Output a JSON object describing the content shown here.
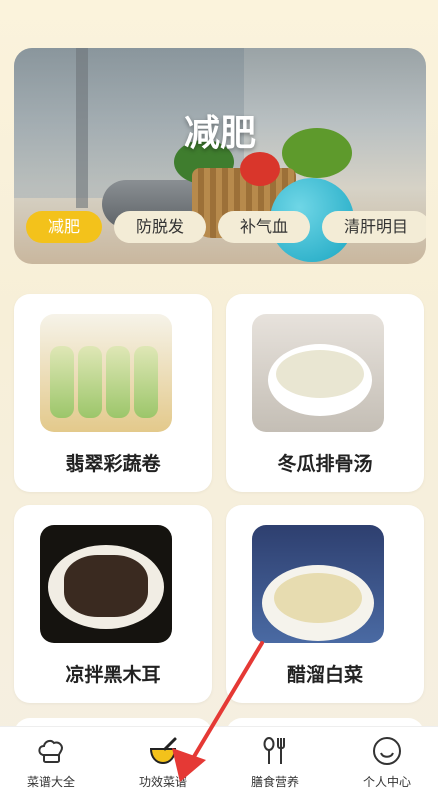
{
  "banner": {
    "title": "减肥",
    "chips": [
      {
        "label": "减肥",
        "active": true
      },
      {
        "label": "防脱发",
        "active": false
      },
      {
        "label": "补气血",
        "active": false
      },
      {
        "label": "清肝明目",
        "active": false
      }
    ]
  },
  "recipes": [
    {
      "name": "翡翠彩蔬卷"
    },
    {
      "name": "冬瓜排骨汤"
    },
    {
      "name": "凉拌黑木耳"
    },
    {
      "name": "醋溜白菜"
    }
  ],
  "tabbar": {
    "items": [
      {
        "label": "菜谱大全",
        "icon": "chef-hat-icon"
      },
      {
        "label": "功效菜谱",
        "icon": "mortar-bowl-icon",
        "active": true
      },
      {
        "label": "膳食营养",
        "icon": "spoon-fork-icon"
      },
      {
        "label": "个人中心",
        "icon": "smiley-face-icon"
      }
    ]
  },
  "colors": {
    "accent": "#f3c21b",
    "arrow": "#e53935",
    "chip_bg": "#f3ecd6"
  }
}
